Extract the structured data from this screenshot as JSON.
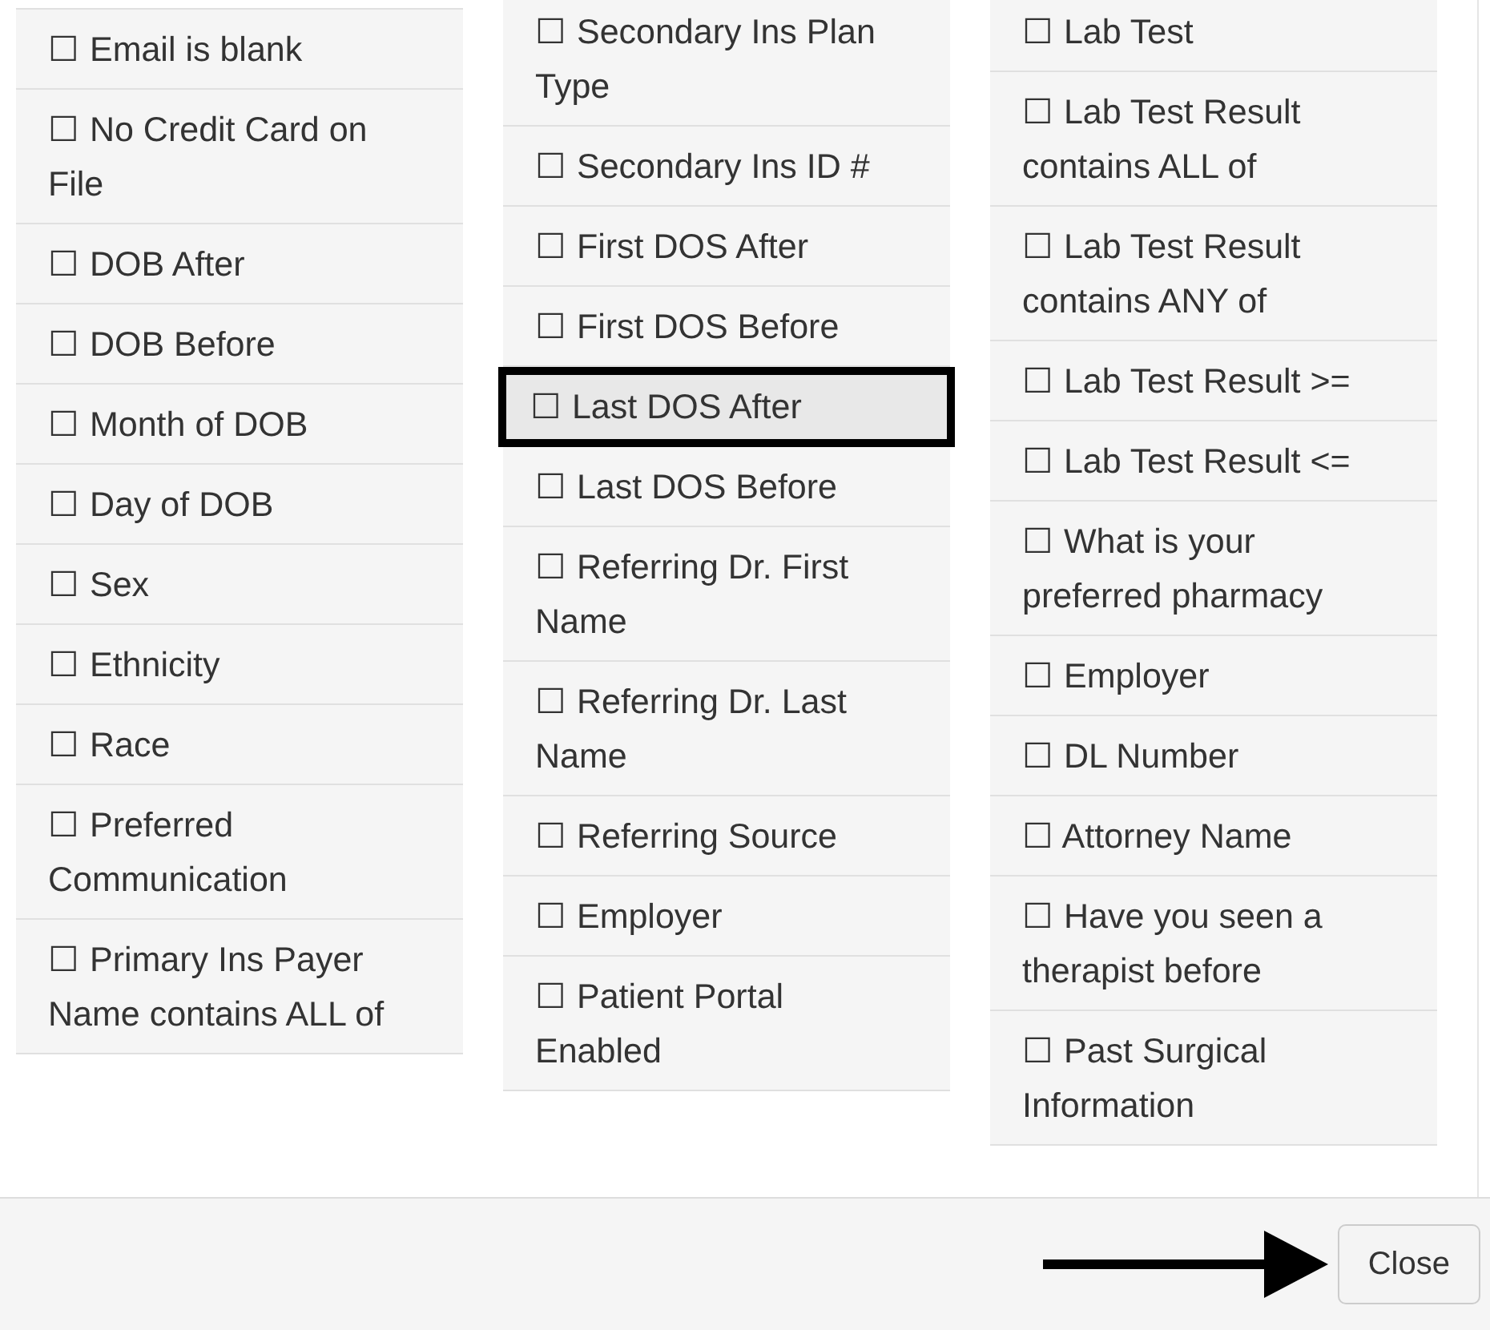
{
  "columns": [
    {
      "items": [
        {
          "label": "☐ Email is blank",
          "highlighted": false
        },
        {
          "label": "☐ No Credit Card on File",
          "highlighted": false
        },
        {
          "label": "☐ DOB After",
          "highlighted": false
        },
        {
          "label": "☐ DOB Before",
          "highlighted": false
        },
        {
          "label": "☐ Month of DOB",
          "highlighted": false
        },
        {
          "label": "☐ Day of DOB",
          "highlighted": false
        },
        {
          "label": "☐ Sex",
          "highlighted": false
        },
        {
          "label": "☐ Ethnicity",
          "highlighted": false
        },
        {
          "label": "☐ Race",
          "highlighted": false
        },
        {
          "label": "☐ Preferred Communication",
          "highlighted": false
        },
        {
          "label": "☐ Primary Ins Payer Name contains ALL of",
          "highlighted": false
        }
      ]
    },
    {
      "items": [
        {
          "label": "☐ Secondary Ins Plan Type",
          "highlighted": false
        },
        {
          "label": "☐ Secondary Ins ID #",
          "highlighted": false
        },
        {
          "label": "☐ First DOS After",
          "highlighted": false
        },
        {
          "label": "☐ First DOS Before",
          "highlighted": false
        },
        {
          "label": "☐ Last DOS After",
          "highlighted": true
        },
        {
          "label": "☐ Last DOS Before",
          "highlighted": false
        },
        {
          "label": "☐ Referring Dr. First Name",
          "highlighted": false
        },
        {
          "label": "☐ Referring Dr. Last Name",
          "highlighted": false
        },
        {
          "label": "☐ Referring Source",
          "highlighted": false
        },
        {
          "label": "☐ Employer",
          "highlighted": false
        },
        {
          "label": "☐ Patient Portal Enabled",
          "highlighted": false
        }
      ]
    },
    {
      "items": [
        {
          "label": "☐ Lab Test",
          "highlighted": false
        },
        {
          "label": "☐ Lab Test Result contains ALL of",
          "highlighted": false
        },
        {
          "label": "☐ Lab Test Result contains ANY of",
          "highlighted": false
        },
        {
          "label": "☐ Lab Test Result >=",
          "highlighted": false
        },
        {
          "label": "☐ Lab Test Result <=",
          "highlighted": false
        },
        {
          "label": "☐ What is your preferred pharmacy",
          "highlighted": false
        },
        {
          "label": "☐ Employer",
          "highlighted": false
        },
        {
          "label": "☐ DL Number",
          "highlighted": false
        },
        {
          "label": "☐ Attorney Name",
          "highlighted": false
        },
        {
          "label": "☐ Have you seen a therapist before",
          "highlighted": false
        },
        {
          "label": "☐ Past Surgical Information",
          "highlighted": false
        }
      ]
    }
  ],
  "footer": {
    "close_button": "Close"
  }
}
